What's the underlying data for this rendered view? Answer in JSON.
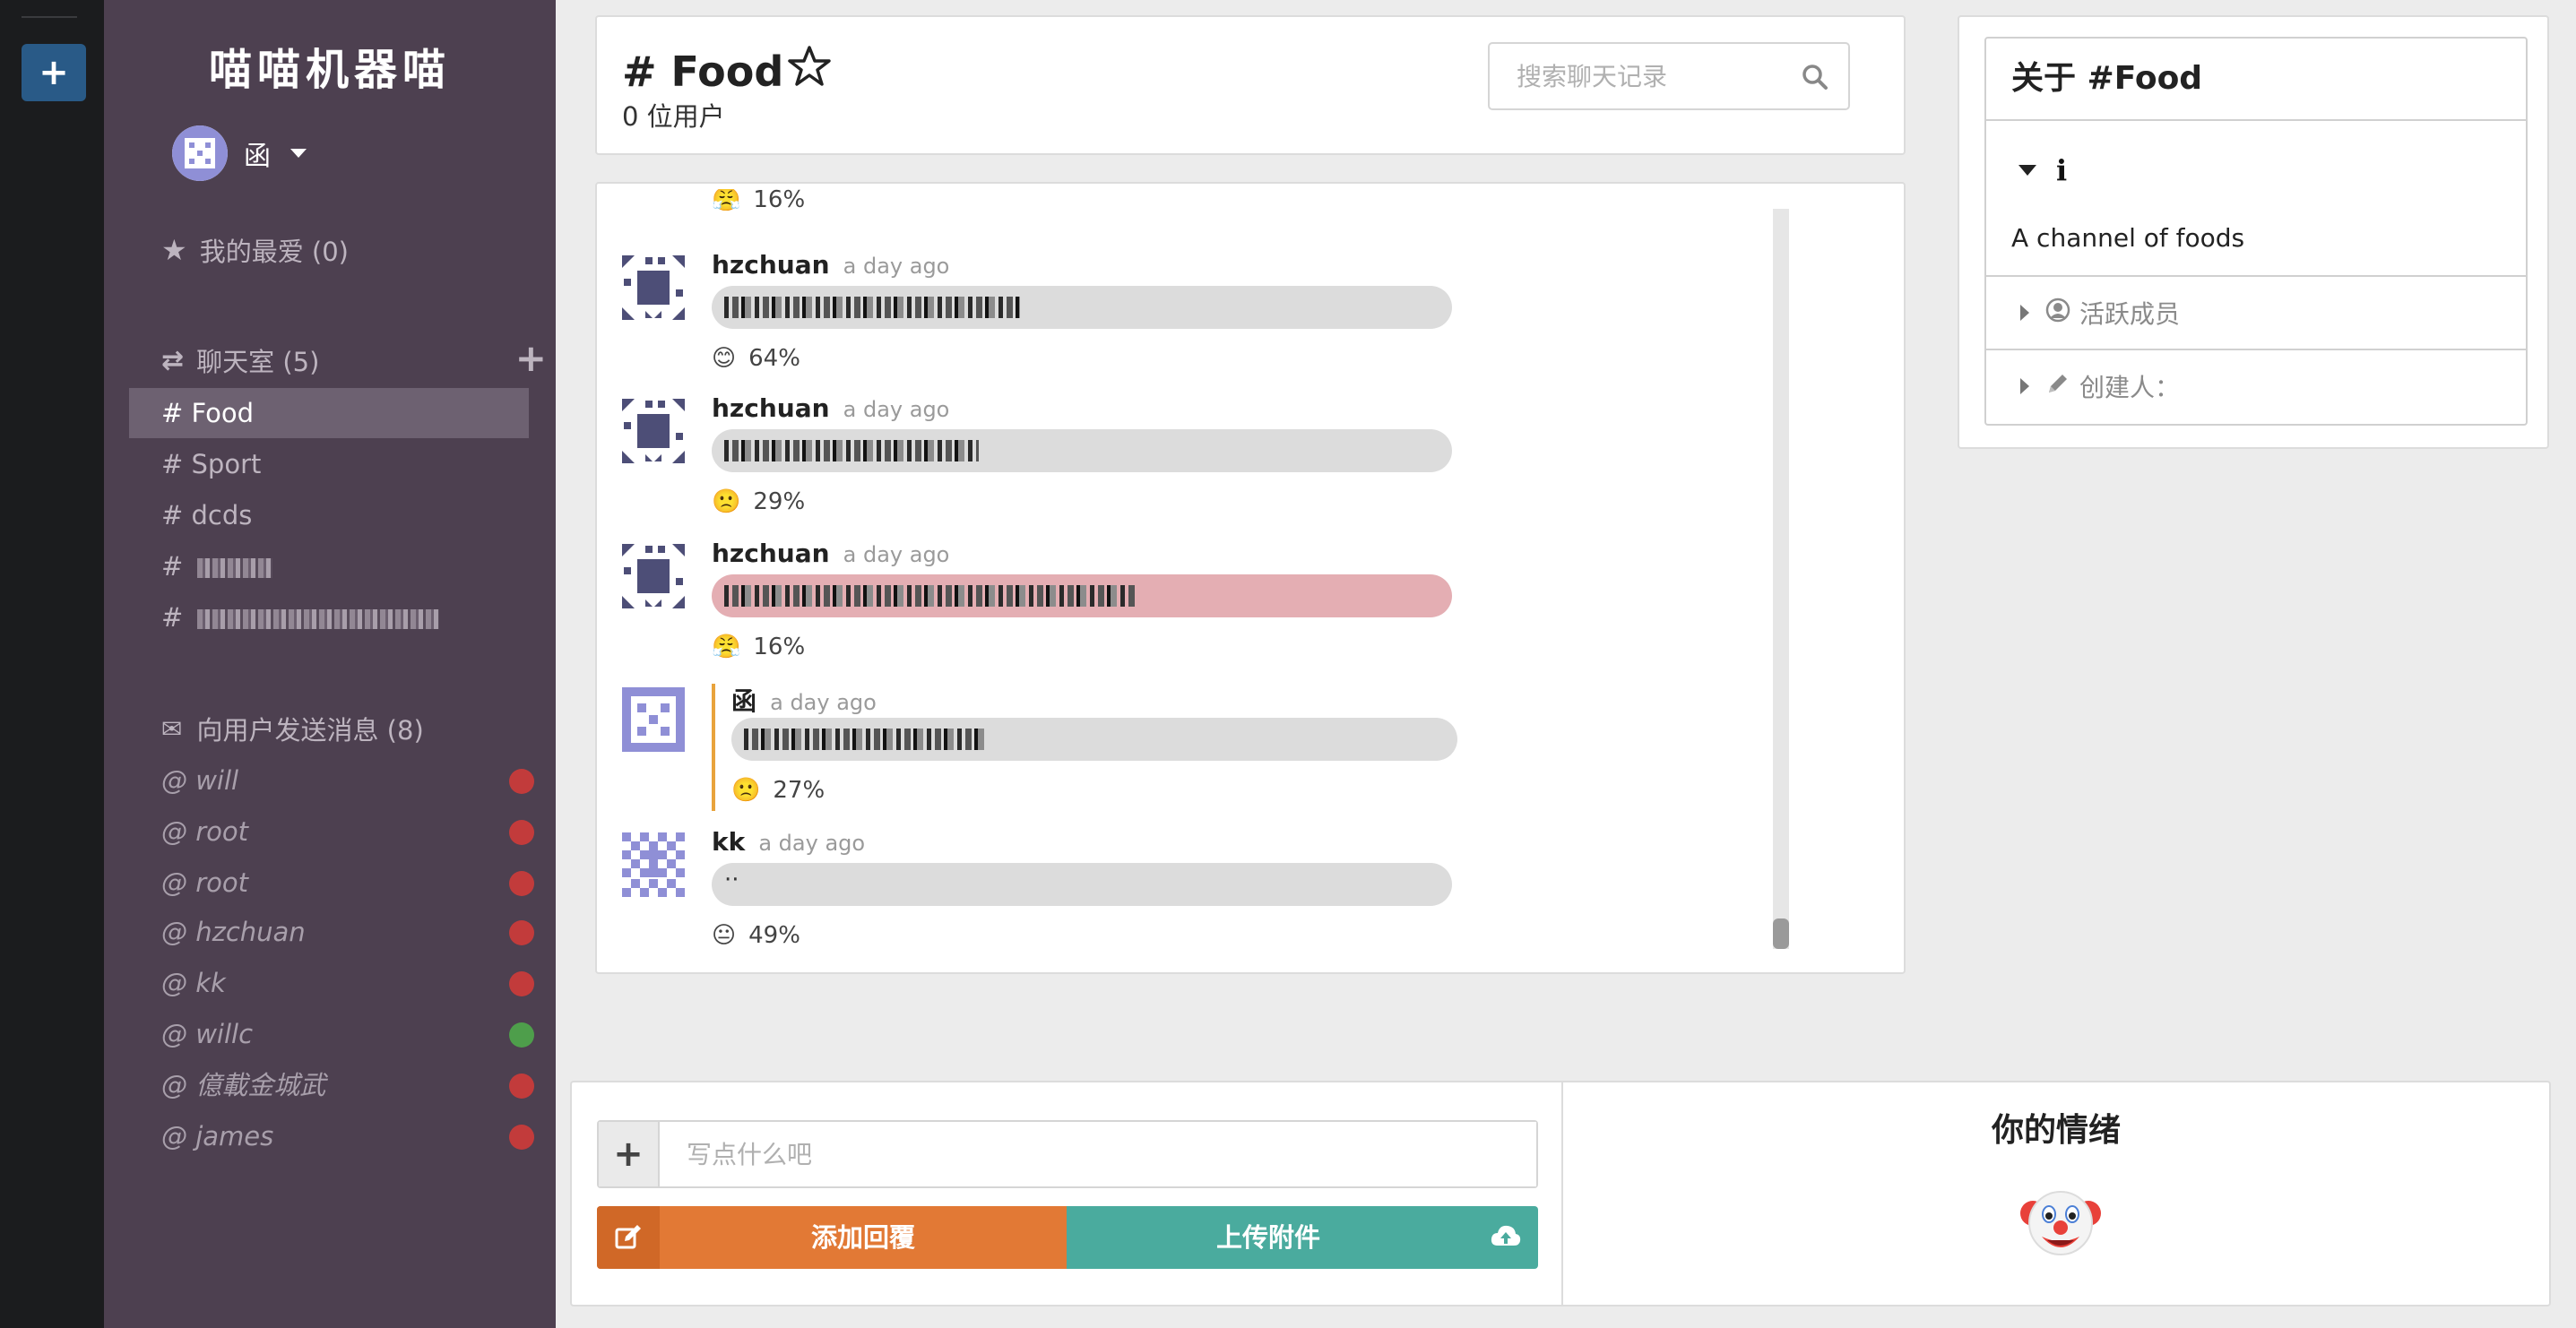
{
  "sidebar": {
    "logo": "喵喵机器喵",
    "user": {
      "name": "函"
    },
    "favorites_label": "我的最爱 (0)",
    "rooms_label": "聊天室 (5)",
    "rooms": [
      {
        "label": "# Food",
        "active": true
      },
      {
        "label": "# Sport"
      },
      {
        "label": "# dcds"
      },
      {
        "label": "#"
      },
      {
        "label": "#"
      }
    ],
    "dm_label": "向用户发送消息 (8)",
    "dms": [
      {
        "label": "@ will",
        "online": false
      },
      {
        "label": "@ root",
        "online": false
      },
      {
        "label": "@ root",
        "online": false
      },
      {
        "label": "@ hzchuan",
        "online": false
      },
      {
        "label": "@ kk",
        "online": false
      },
      {
        "label": "@ willc",
        "online": true
      },
      {
        "label": "@ 億載金城武",
        "online": false
      },
      {
        "label": "@ james",
        "online": false
      }
    ]
  },
  "header": {
    "title": "# Food",
    "subtitle": "0 位用户",
    "search_placeholder": "搜索聊天记录"
  },
  "messages": [
    {
      "author": "hzchuan",
      "time": "a day ago",
      "emotion_pct": "64%",
      "emoji": "😊",
      "sentiment": "neutral"
    },
    {
      "author": "hzchuan",
      "time": "a day ago",
      "emotion_pct": "29%",
      "emoji": "🙁",
      "sentiment": "neutral"
    },
    {
      "author": "hzchuan",
      "time": "a day ago",
      "emotion_pct": "16%",
      "emoji": "😤",
      "sentiment": "negative"
    },
    {
      "author": "函",
      "time": "a day ago",
      "emotion_pct": "27%",
      "emoji": "🙁",
      "sentiment": "neutral",
      "is_reply": true
    },
    {
      "author": "kk",
      "time": "a day ago",
      "emotion_pct": "49%",
      "emoji": "😐",
      "sentiment": "neutral",
      "text": "··"
    }
  ],
  "partial_top_pct": "16%",
  "about": {
    "title": "关于 #Food",
    "description": "A channel of foods",
    "active_members_label": "活跃成员",
    "creator_label": "创建人："
  },
  "composer": {
    "placeholder": "写点什么吧",
    "reply_label": "添加回覆",
    "upload_label": "上传附件"
  },
  "mood": {
    "title": "你的情绪",
    "emoji": "clown-face"
  },
  "colors": {
    "sidebar_bg": "#4d4050",
    "rail_bg": "#1b1c1e",
    "reply_button": "#e27935",
    "upload_button": "#4aab9e",
    "negative_bubble": "#e4aeb3",
    "offline_dot": "#c23b3b",
    "online_dot": "#4e9e4b"
  }
}
